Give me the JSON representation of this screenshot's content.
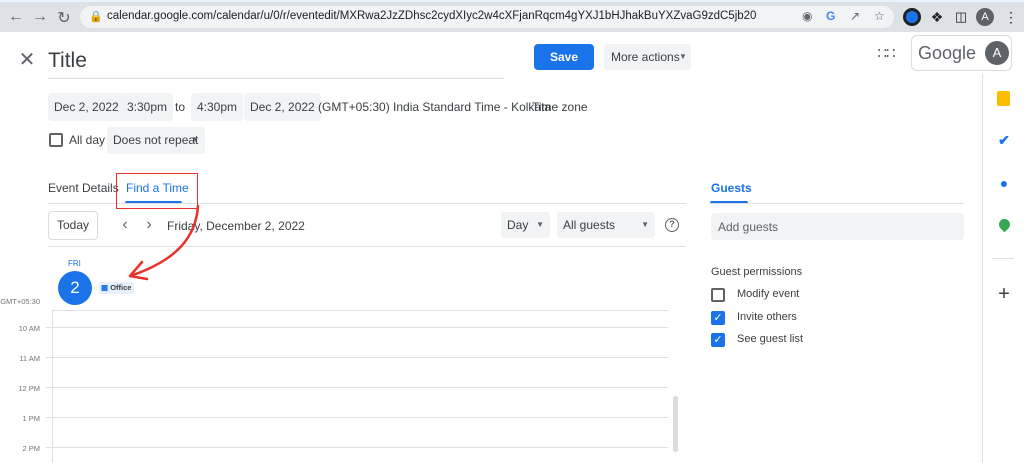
{
  "browser": {
    "url": "calendar.google.com/calendar/u/0/r/eventedit/MXRwa2JzZDhsc2cydXIyc2w4cXFjanRqcm4gYXJ1bHJhakBuYXZvaG9zdC5jb20",
    "profile_initial": "A",
    "extension_g": "G"
  },
  "header": {
    "title": "Title",
    "save_label": "Save",
    "more_actions_label": "More actions",
    "google_label": "Google",
    "account_initial": "A"
  },
  "datetime": {
    "start_date": "Dec 2, 2022",
    "start_time": "3:30pm",
    "to_label": "to",
    "end_time": "4:30pm",
    "end_date": "Dec 2, 2022",
    "timezone_text": "(GMT+05:30) India Standard Time - Kolkata",
    "timezone_link": "Time zone",
    "all_day_label": "All day",
    "repeat_label": "Does not repeat"
  },
  "tabs": {
    "event_details": "Event Details",
    "find_a_time": "Find a Time"
  },
  "toolbar": {
    "today_label": "Today",
    "date_label": "Friday, December 2, 2022",
    "view_select": "Day",
    "guests_select": "All guests"
  },
  "calendar": {
    "day_name": "FRI",
    "day_number": "2",
    "gmt_label": "GMT+05:30",
    "office_label": "Office",
    "hours": [
      "10 AM",
      "11 AM",
      "12 PM",
      "1 PM",
      "2 PM"
    ]
  },
  "guests": {
    "tab_label": "Guests",
    "add_placeholder": "Add guests",
    "permissions_title": "Guest permissions",
    "permissions": [
      {
        "label": "Modify event",
        "checked": false
      },
      {
        "label": "Invite others",
        "checked": true
      },
      {
        "label": "See guest list",
        "checked": true
      }
    ]
  },
  "colors": {
    "accent": "#1a73e8",
    "annotation": "#e8332c"
  }
}
